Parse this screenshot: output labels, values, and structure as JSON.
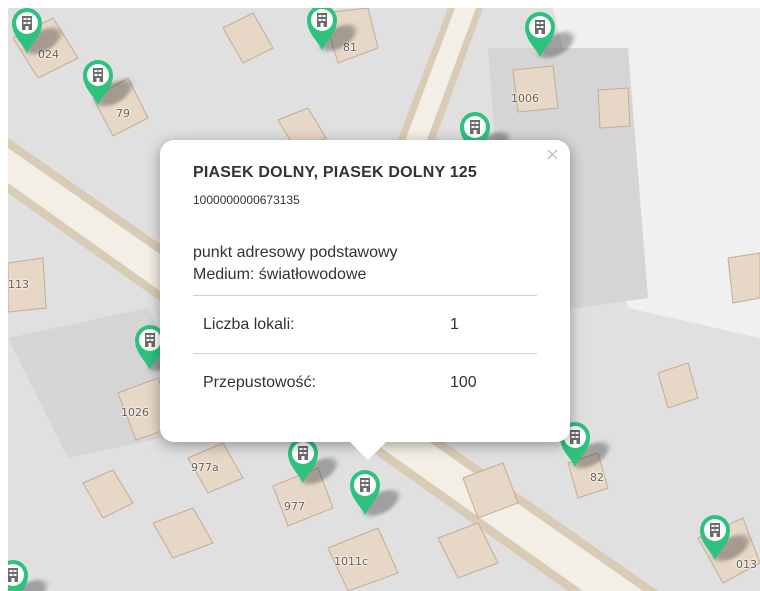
{
  "map": {
    "colors": {
      "parcel": "#e0e0e0",
      "block": "#d3d3d3",
      "building": "#e6d7c6",
      "building_stroke": "#c4ac94",
      "road": "#f3efe6",
      "road_edge": "#d9cbb5",
      "pin": "#2ec27e"
    },
    "labels": {
      "l024": "024",
      "l79": "79",
      "l81": "81",
      "l1006": "1006",
      "l113": "113",
      "l1026": "1026",
      "l977a": "977a",
      "l977": "977",
      "l1011c": "1011c",
      "l82": "82",
      "l013": "013"
    },
    "marker_icon": "apartment-building-icon"
  },
  "popup": {
    "close_label": "×",
    "title": "PIASEK DOLNY, PIASEK DOLNY 125",
    "id": "1000000000673135",
    "type": "punkt adresowy podstawowy",
    "medium": "Medium: światłowodowe",
    "rows": [
      {
        "key": "Liczba lokali:",
        "value": "1"
      },
      {
        "key": "Przepustowość:",
        "value": "100"
      }
    ]
  }
}
